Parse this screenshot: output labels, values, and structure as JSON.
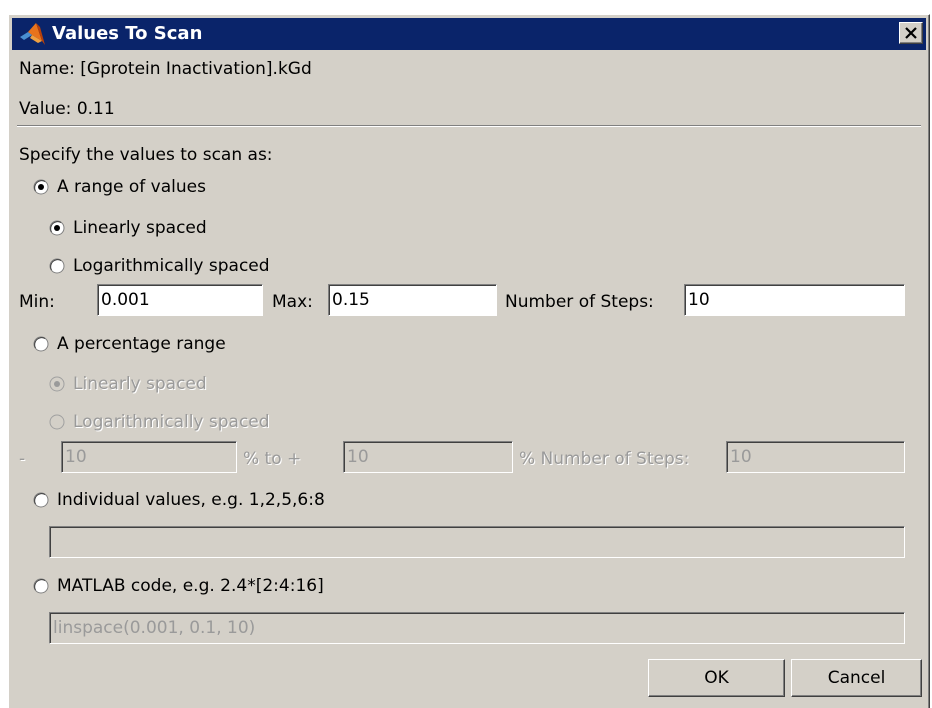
{
  "window": {
    "title": "Values To Scan",
    "icon": "matlab-icon"
  },
  "info": {
    "name_label": "Name: [Gprotein Inactivation].kGd",
    "value_label": "Value: 0.11"
  },
  "prompt": "Specify the values to scan as:",
  "options": {
    "range": {
      "label": "A range of values",
      "selected": true
    },
    "range_linear": {
      "label": "Linearly spaced",
      "selected": true
    },
    "range_log": {
      "label": "Logarithmically spaced",
      "selected": false
    },
    "range_fields": {
      "min_label": "Min:",
      "min_value": "0.001",
      "max_label": "Max:",
      "max_value": "0.15",
      "steps_label": "Number of Steps:",
      "steps_value": "10"
    },
    "percentage": {
      "label": "A percentage range",
      "selected": false
    },
    "percentage_linear": {
      "label": "Linearly spaced",
      "selected": true
    },
    "percentage_log": {
      "label": "Logarithmically spaced",
      "selected": false
    },
    "percentage_fields": {
      "minus_label": "-",
      "minus_value": "10",
      "to_label": "%  to  +",
      "plus_value": "10",
      "steps_label": "% Number of Steps:",
      "steps_value": "10"
    },
    "individual": {
      "label": "Individual values, e.g. 1,2,5,6:8",
      "selected": false,
      "value": ""
    },
    "matlab": {
      "label": "MATLAB code, e.g. 2.4*[2:4:16]",
      "selected": false,
      "value": "linspace(0.001, 0.1, 10)"
    }
  },
  "buttons": {
    "ok": "OK",
    "cancel": "Cancel"
  }
}
